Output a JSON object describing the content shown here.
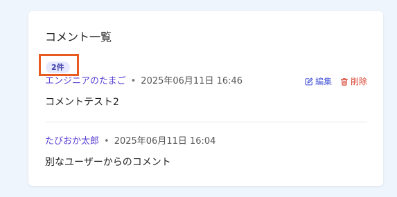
{
  "comments_panel": {
    "title": "コメント一覧",
    "count_badge": "2件",
    "actions": {
      "edit_label": "編集",
      "delete_label": "削除"
    },
    "comments": [
      {
        "author": "エンジニアのたまご",
        "separator": "•",
        "timestamp": "2025年06月11日 16:46",
        "body": "コメントテスト2",
        "editable": true
      },
      {
        "author": "たびおか太郎",
        "separator": "•",
        "timestamp": "2025年06月11日 16:04",
        "body": "別なユーザーからのコメント",
        "editable": false
      }
    ]
  },
  "colors": {
    "page_background": "#eff5fc",
    "author": "#5a3fd1",
    "edit_action": "#4a58d8",
    "delete_action": "#d9412f",
    "badge_background": "#e7e9ff",
    "highlight_box": "#e85a1f"
  },
  "icons": {
    "edit": "pencil-square-icon",
    "delete": "trash-icon"
  }
}
